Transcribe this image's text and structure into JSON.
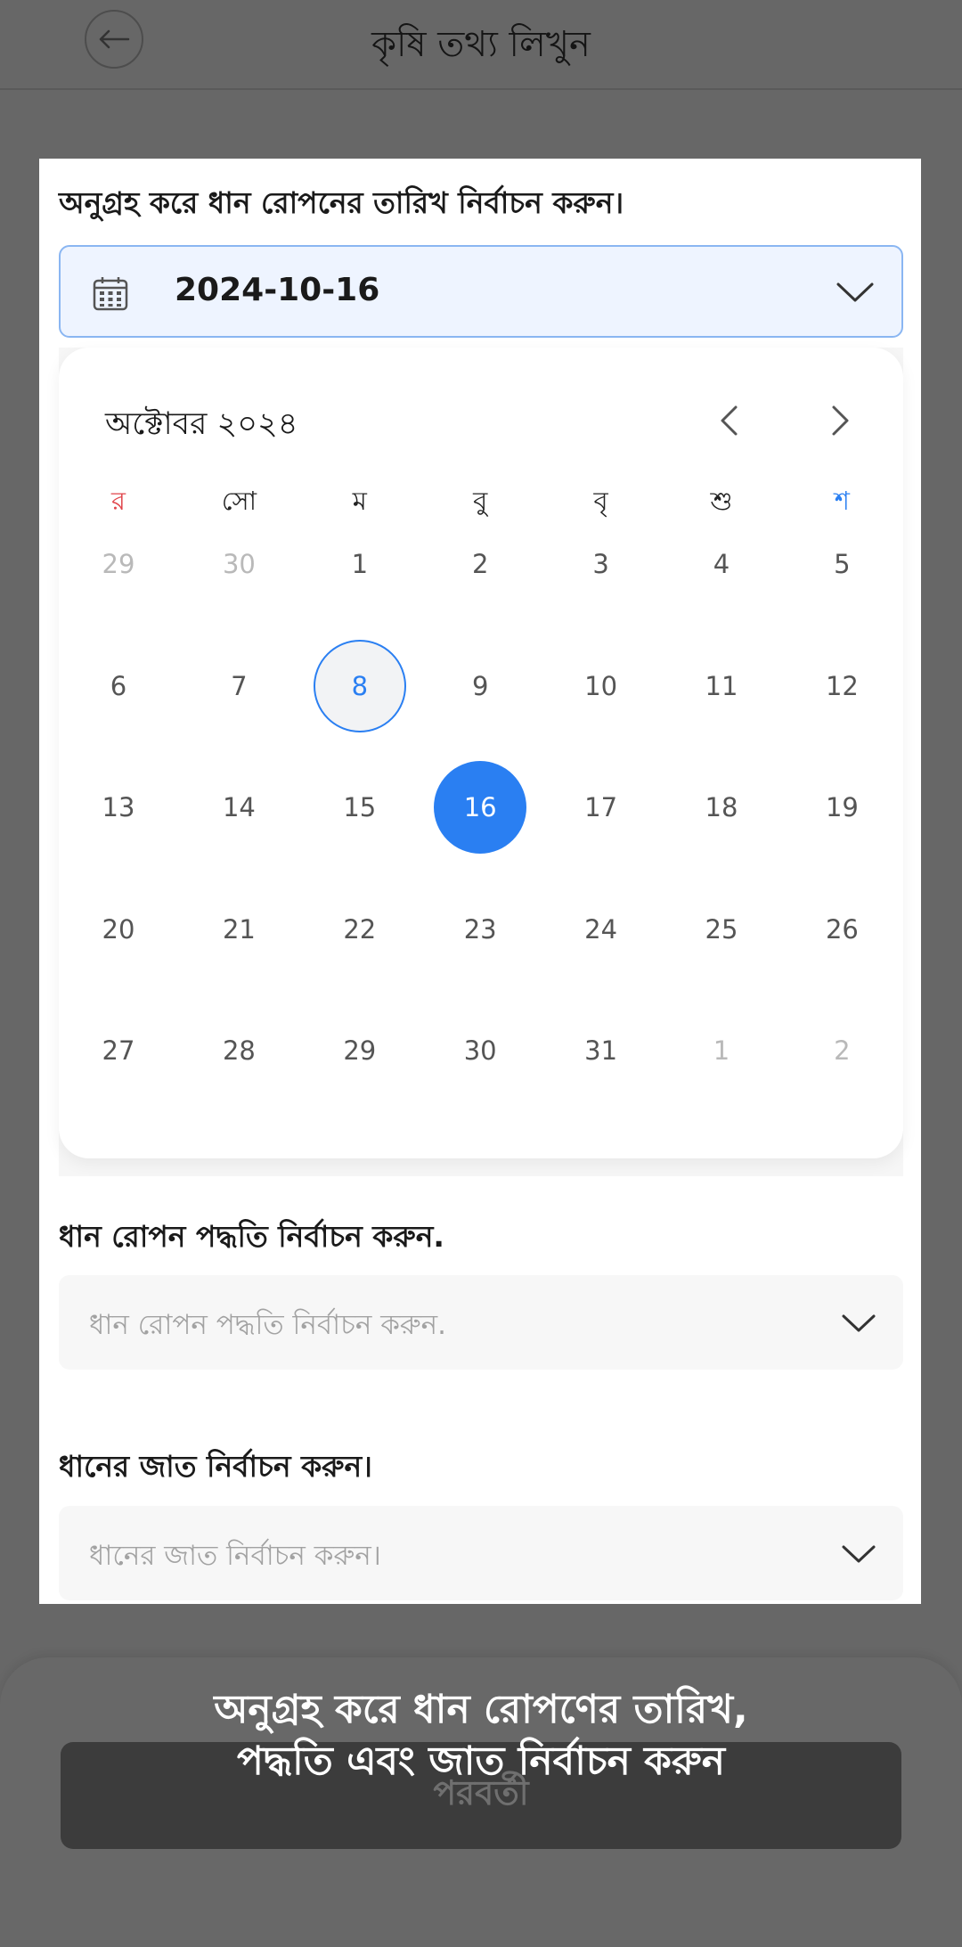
{
  "header": {
    "title": "কৃষি তথ্য লিখুন",
    "back_icon": "arrow-left-icon"
  },
  "date_section": {
    "label": "অনুগ্রহ করে ধান রোপনের তারিখ নির্বাচন করুন।",
    "value": "2024-10-16",
    "icon": "calendar-icon"
  },
  "calendar": {
    "month_title": "অক্টোবর ২০২৪",
    "weekdays": [
      "র",
      "সো",
      "ম",
      "বু",
      "বৃ",
      "শু",
      "শ"
    ],
    "weeks": [
      [
        "29",
        "30",
        "1",
        "2",
        "3",
        "4",
        "5"
      ],
      [
        "6",
        "7",
        "8",
        "9",
        "10",
        "11",
        "12"
      ],
      [
        "13",
        "14",
        "15",
        "16",
        "17",
        "18",
        "19"
      ],
      [
        "20",
        "21",
        "22",
        "23",
        "24",
        "25",
        "26"
      ],
      [
        "27",
        "28",
        "29",
        "30",
        "31",
        "1",
        "2"
      ]
    ],
    "today": "8",
    "selected": "16",
    "colors": {
      "accent": "#2a7ff2",
      "sunday": "#e0444a",
      "saturday": "#2a7ff2"
    }
  },
  "method_section": {
    "label": "ধান রোপন পদ্ধতি নির্বাচন করুন.",
    "placeholder": "ধান রোপন পদ্ধতি নির্বাচন করুন."
  },
  "variety_section": {
    "label": "ধানের জাত নির্বাচন করুন।",
    "placeholder": "ধানের জাত নির্বাচন করুন।"
  },
  "footer": {
    "next_label": "পরবর্তী",
    "toast_line1": "অনুগ্রহ করে ধান রোপণের তারিখ,",
    "toast_line2": "পদ্ধতি এবং জাত নির্বাচন করুন"
  }
}
